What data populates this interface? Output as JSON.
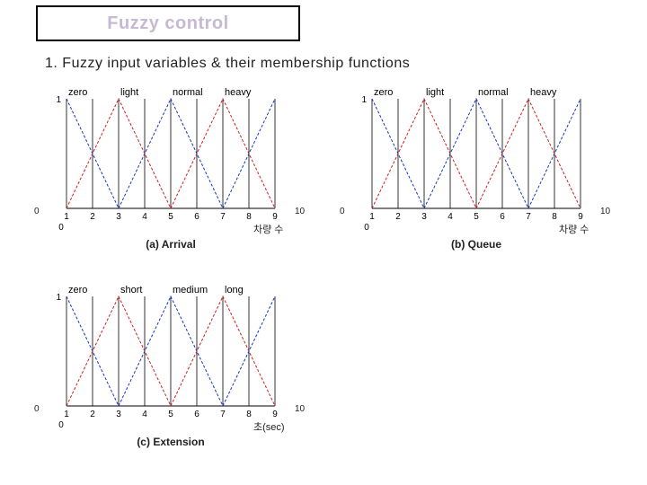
{
  "title": "Fuzzy control",
  "section": "1. Fuzzy input variables & their membership functions",
  "outer": {
    "zero": "0",
    "ten": "10"
  },
  "axis_small_zero": "0",
  "chart_data": [
    {
      "id": "arrival",
      "caption": "(a) Arrival",
      "x_axis_label": "차량 수",
      "x_ticks": [
        "1",
        "2",
        "3",
        "4",
        "5",
        "6",
        "7",
        "8",
        "9"
      ],
      "x_range": [
        1,
        9
      ],
      "y_max_label": "1",
      "mf": [
        {
          "name": "zero",
          "at": 1,
          "color": "blue"
        },
        {
          "name": "light",
          "at": 3,
          "color": "red"
        },
        {
          "name": "normal",
          "at": 5,
          "color": "blue"
        },
        {
          "name": "heavy",
          "at": 7,
          "color": "red"
        },
        {
          "name": "_end",
          "at": 9,
          "color": "blue",
          "hidden": true
        }
      ],
      "mf_labels": {
        "zero": "zero",
        "light": "light",
        "normal": "normal",
        "heavy": "heavy"
      }
    },
    {
      "id": "queue",
      "caption": "(b) Queue",
      "x_axis_label": "차량 수",
      "x_ticks": [
        "1",
        "2",
        "3",
        "4",
        "5",
        "6",
        "7",
        "8",
        "9"
      ],
      "x_range": [
        1,
        9
      ],
      "y_max_label": "1",
      "mf": [
        {
          "name": "zero",
          "at": 1,
          "color": "blue"
        },
        {
          "name": "light",
          "at": 3,
          "color": "red"
        },
        {
          "name": "normal",
          "at": 5,
          "color": "blue"
        },
        {
          "name": "heavy",
          "at": 7,
          "color": "red"
        },
        {
          "name": "_end",
          "at": 9,
          "color": "blue",
          "hidden": true
        }
      ],
      "mf_labels": {
        "zero": "zero",
        "light": "light",
        "normal": "normal",
        "heavy": "heavy"
      }
    },
    {
      "id": "extension",
      "caption": "(c) Extension",
      "x_axis_label": "초(sec)",
      "x_ticks": [
        "1",
        "2",
        "3",
        "4",
        "5",
        "6",
        "7",
        "8",
        "9"
      ],
      "x_range": [
        1,
        9
      ],
      "y_max_label": "1",
      "mf": [
        {
          "name": "zero",
          "at": 1,
          "color": "blue"
        },
        {
          "name": "short",
          "at": 3,
          "color": "red"
        },
        {
          "name": "medium",
          "at": 5,
          "color": "blue"
        },
        {
          "name": "long",
          "at": 7,
          "color": "red"
        },
        {
          "name": "_end",
          "at": 9,
          "color": "blue",
          "hidden": true
        }
      ],
      "mf_labels": {
        "zero": "zero",
        "short": "short",
        "medium": "medium",
        "long": "long"
      }
    }
  ]
}
